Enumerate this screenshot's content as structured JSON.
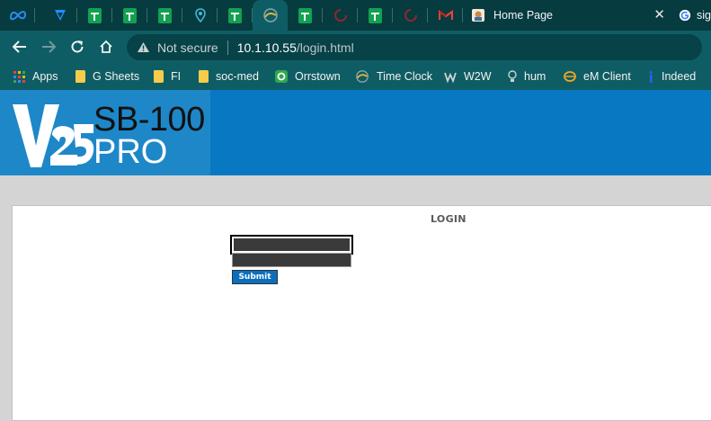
{
  "tabs": {
    "pinned_icons": [
      "meta-icon",
      "vector-logo-icon",
      "google-sheets-icon",
      "google-sheets-icon",
      "google-sheets-icon",
      "location-pin-icon",
      "google-sheets-icon",
      "timeclock-icon",
      "google-sheets-icon",
      "spinner-icon",
      "google-sheets-icon",
      "spinner-icon",
      "gmail-icon"
    ],
    "active_title": "Home Page",
    "last_title": "sig"
  },
  "toolbar": {
    "not_secure": "Not secure",
    "url_host": "10.1.10.55",
    "url_path": "/login.html"
  },
  "bookmarks": [
    {
      "label": "Apps",
      "icon": "apps-grid-icon"
    },
    {
      "label": "G Sheets",
      "icon": "folder-icon"
    },
    {
      "label": "FI",
      "icon": "folder-icon"
    },
    {
      "label": "soc-med",
      "icon": "folder-icon"
    },
    {
      "label": "Orrstown",
      "icon": "orrstown-icon"
    },
    {
      "label": "Time Clock",
      "icon": "timeclock-icon"
    },
    {
      "label": "W2W",
      "icon": "w2w-icon"
    },
    {
      "label": "hum",
      "icon": "bulb-icon"
    },
    {
      "label": "eM Client",
      "icon": "emclient-icon"
    },
    {
      "label": "Indeed",
      "icon": "indeed-icon"
    }
  ],
  "page": {
    "logo_mark": "V25",
    "logo_line1": "SB-100",
    "logo_line2": "PRO",
    "login_title": "LOGIN",
    "submit_label": "Submit"
  },
  "colors": {
    "tab_strip": "#063b40",
    "toolbar": "#0f5d64",
    "banner": "#0978c3",
    "logo_panel": "#1e87c8",
    "submit": "#0b6fbd"
  }
}
